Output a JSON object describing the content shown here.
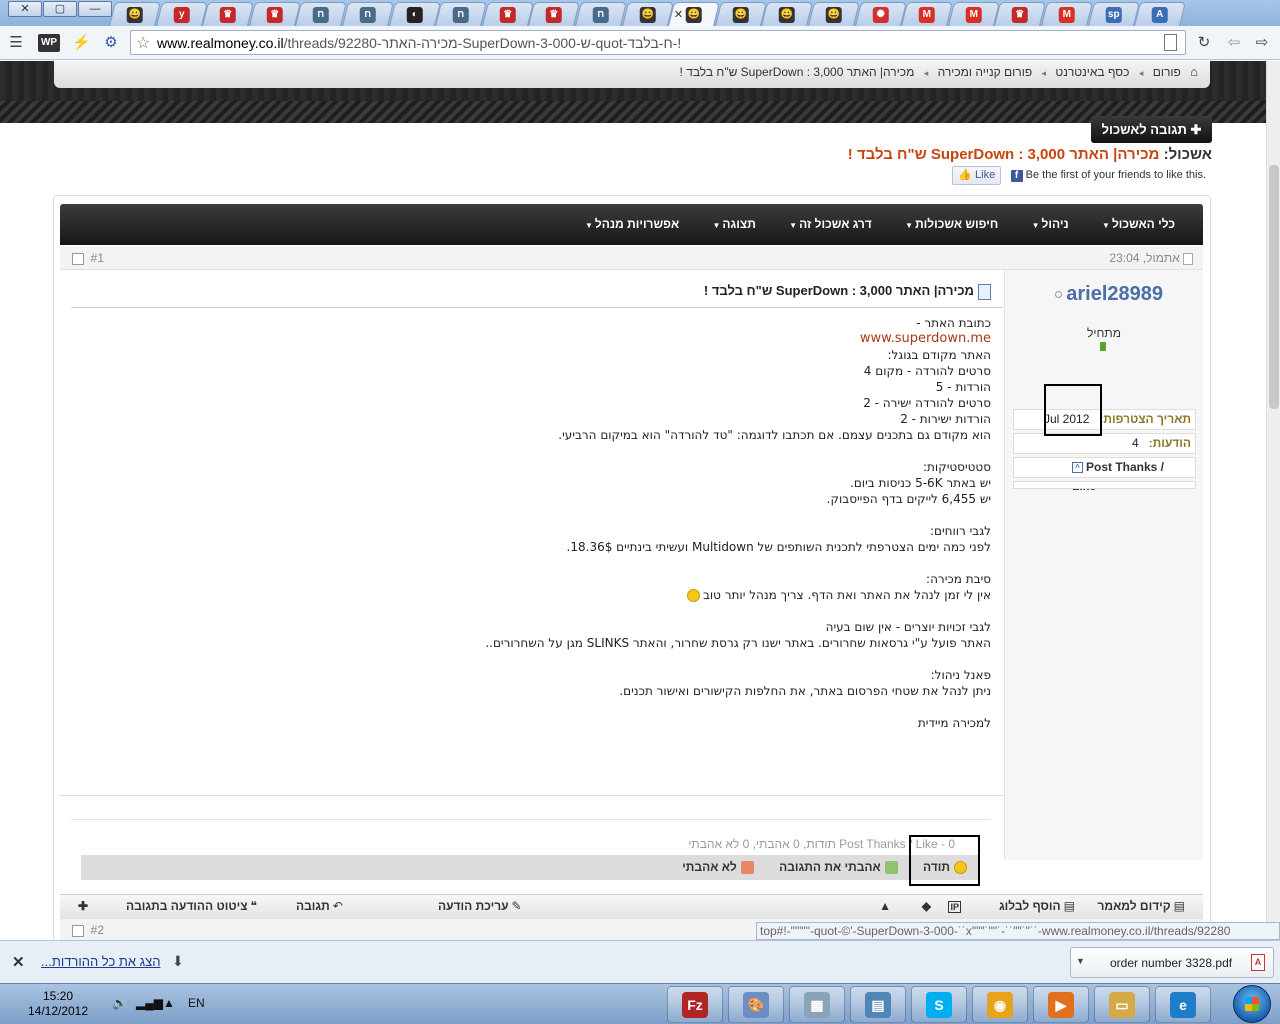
{
  "browser": {
    "window_buttons": [
      "✕",
      "▢",
      "—"
    ],
    "tabs": [
      {
        "color": "#333333",
        "glyph": "😀",
        "active": false
      },
      {
        "color": "#c62828",
        "glyph": "y",
        "active": false
      },
      {
        "color": "#c62828",
        "glyph": "♛",
        "active": false
      },
      {
        "color": "#c62828",
        "glyph": "♛",
        "active": false
      },
      {
        "color": "#4a6a8a",
        "glyph": "ח",
        "active": false
      },
      {
        "color": "#4a6a8a",
        "glyph": "ח",
        "active": false
      },
      {
        "color": "#222222",
        "glyph": "◐",
        "active": false
      },
      {
        "color": "#4a6a8a",
        "glyph": "ח",
        "active": false
      },
      {
        "color": "#c62828",
        "glyph": "♛",
        "active": false
      },
      {
        "color": "#c62828",
        "glyph": "♛",
        "active": false
      },
      {
        "color": "#4a6a8a",
        "glyph": "ח",
        "active": false
      },
      {
        "color": "#333333",
        "glyph": "😀",
        "active": false
      },
      {
        "color": "#333333",
        "glyph": "😀",
        "active": true
      },
      {
        "color": "#333333",
        "glyph": "😀",
        "active": false
      },
      {
        "color": "#333333",
        "glyph": "😀",
        "active": false
      },
      {
        "color": "#333333",
        "glyph": "😀",
        "active": false
      },
      {
        "color": "#d32f2f",
        "glyph": "✺",
        "active": false
      },
      {
        "color": "#d93025",
        "glyph": "M",
        "active": false
      },
      {
        "color": "#d93025",
        "glyph": "M",
        "active": false
      },
      {
        "color": "#c62828",
        "glyph": "♛",
        "active": false
      },
      {
        "color": "#d93025",
        "glyph": "M",
        "active": false
      },
      {
        "color": "#3b6db5",
        "glyph": "sp",
        "active": false
      },
      {
        "color": "#3b6db5",
        "glyph": "A",
        "active": false
      }
    ],
    "url_host": "www.realmoney.co.il",
    "url_path": "/threads/92280-מכירה-האתר-SuperDown-3-000-ש-quot-ח-בלבד-!"
  },
  "breadcrumb": [
    "פורום",
    "כסף באינטרנט",
    "פורום קנייה ומכירה",
    "מכירה| האתר SuperDown : 3,000 ש\"ח בלבד !"
  ],
  "reply_button": "תגובה לאשכול",
  "thread": {
    "prefix": "אשכול:",
    "title": "מכירה| האתר SuperDown : 3,000 ש\"ח בלבד !"
  },
  "facebook": {
    "like_label": "Like",
    "text": "Be the first of your friends to like this."
  },
  "navbar": [
    "כלי האשכול",
    "ניהול",
    "חיפוש אשכולות",
    "דרג אשכול זה",
    "תצוגה",
    "אפשרויות מנהל"
  ],
  "post": {
    "date": "אתמול, 23:04",
    "number": "#1",
    "title": "מכירה| האתר SuperDown : 3,000 ש\"ח בלבד !",
    "user": {
      "name": "ariel28989",
      "title": "מתחיל",
      "join_label": "תאריך הצטרפות:",
      "join_date": "Jul 2012",
      "posts_label": "הודעות:",
      "posts": "4",
      "thanks_label": "Post Thanks / Like"
    },
    "lines": [
      "כתובת האתר -",
      "www.superdown.me",
      "האתר מקודם בגוגל:",
      "סרטים להורדה - מקום 4",
      "הורדות - 5",
      "סרטים להורדה ישירה - 2",
      "הורדות ישירות - 2",
      "הוא מקודם גם בתכנים עצמם. אם תכתבו לדוגמה: \"טד להורדה\" הוא במיקום הרביעי.",
      "",
      "סטטיסטיקות:",
      "יש באתר 5-6K כניסות ביום.",
      "יש 6,455 לייקים בדף הפייסבוק.",
      "",
      "לגבי רווחים:",
      "לפני כמה ימים הצטרפתי לתכנית השותפים של Multidown ועשיתי בינתיים 18.36$.",
      "",
      "סיבת מכירה:",
      "אין לי זמן לנהל את האתר ואת הדף. צריך מנהל יותר טוב",
      "",
      "לגבי זכויות יוצרים - אין שום בעיה",
      "האתר פועל ע\"י גרסאות שחרורים. באתר ישנו רק גרסת שחרור, והאתר SLINKS מגן על השחרורים..",
      "",
      "פאנל ניהול:",
      "ניתן לנהל את שטחי הפרסום באתר, את החלפות הקישורים ואישור תכנים.",
      "",
      "למכירה מיידית"
    ],
    "thanks_summary": "Post Thanks / Like - 0 תודות, 0 אהבתי, 0 לא אהבתי",
    "thanks_buttons": [
      "תודה",
      "אהבתי את התגובה",
      "לא אהבתי"
    ],
    "actions_left": [
      "קידום למאמר",
      "הוסף לבלוג"
    ],
    "actions_right": [
      "עריכת הודעה",
      "תגובה",
      "ציטוט ההודעה בתגובה"
    ]
  },
  "post2_number": "#2",
  "status_url": "top#!-\"\"\"'\"-quot-©'-SuperDown-3-000-˙˙x\"\"\"˙\"\"˙-˙˙\"\"˙\"˙˙-www.realmoney.co.il/threads/92280",
  "downloads": {
    "show_all": "הצג את כל ההורדות...",
    "file": "order number 3328.pdf"
  },
  "taskbar": {
    "time": "15:20",
    "date": "14/12/2012",
    "lang": "EN",
    "apps": [
      {
        "name": "filezilla",
        "color": "#b32424",
        "glyph": "Fz"
      },
      {
        "name": "paint",
        "color": "#6a8fc4",
        "glyph": "🎨"
      },
      {
        "name": "calculator",
        "color": "#8aa3b8",
        "glyph": "▦"
      },
      {
        "name": "notes",
        "color": "#4f86b5",
        "glyph": "▤"
      },
      {
        "name": "skype",
        "color": "#00aff0",
        "glyph": "S"
      },
      {
        "name": "chrome",
        "color": "#e8a21b",
        "glyph": "◉"
      },
      {
        "name": "media-player",
        "color": "#e0701b",
        "glyph": "▶"
      },
      {
        "name": "explorer",
        "color": "#d6a948",
        "glyph": "▭"
      },
      {
        "name": "internet-explorer",
        "color": "#1e7cc8",
        "glyph": "e"
      }
    ]
  }
}
